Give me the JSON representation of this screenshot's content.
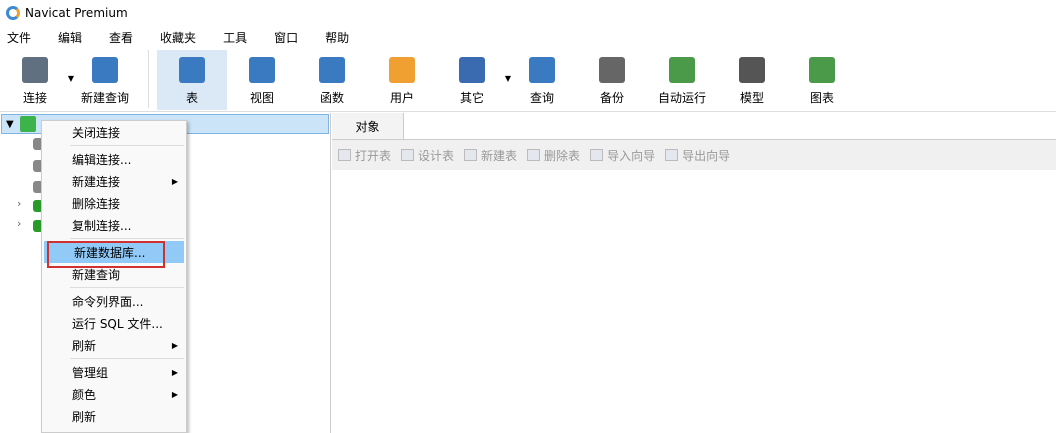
{
  "title": "Navicat Premium",
  "menubar": [
    "文件",
    "编辑",
    "查看",
    "收藏夹",
    "工具",
    "窗口",
    "帮助"
  ],
  "toolbar": [
    {
      "label": "连接",
      "icon": "plug-icon",
      "color": "#607080"
    },
    {
      "label": "新建查询",
      "icon": "new-query-icon",
      "color": "#3a7ac0"
    },
    {
      "label": "表",
      "icon": "table-icon",
      "color": "#3a7ac0",
      "active": true
    },
    {
      "label": "视图",
      "icon": "view-icon",
      "color": "#3a7ac0"
    },
    {
      "label": "函数",
      "icon": "function-icon",
      "color": "#3a7ac0"
    },
    {
      "label": "用户",
      "icon": "user-icon",
      "color": "#f0a030"
    },
    {
      "label": "其它",
      "icon": "tools-icon",
      "color": "#3a6ab0"
    },
    {
      "label": "查询",
      "icon": "query-icon",
      "color": "#3a7ac0"
    },
    {
      "label": "备份",
      "icon": "backup-icon",
      "color": "#666666"
    },
    {
      "label": "自动运行",
      "icon": "schedule-icon",
      "color": "#4a9a4a"
    },
    {
      "label": "模型",
      "icon": "model-icon",
      "color": "#555555"
    },
    {
      "label": "图表",
      "icon": "chart-icon",
      "color": "#4a9a4a"
    }
  ],
  "tabs": {
    "objects": "对象"
  },
  "object_toolbar": [
    "打开表",
    "设计表",
    "新建表",
    "删除表",
    "导入向导",
    "导出向导"
  ],
  "context_menu": [
    {
      "label": "关闭连接"
    },
    {
      "sep": true
    },
    {
      "label": "编辑连接..."
    },
    {
      "label": "新建连接",
      "sub": true
    },
    {
      "label": "删除连接"
    },
    {
      "label": "复制连接..."
    },
    {
      "sep": true
    },
    {
      "label": "新建数据库...",
      "highlight": true
    },
    {
      "label": "新建查询"
    },
    {
      "sep": true
    },
    {
      "label": "命令列界面..."
    },
    {
      "label": "运行 SQL 文件..."
    },
    {
      "label": "刷新",
      "sub": true
    },
    {
      "sep": true
    },
    {
      "label": "管理组",
      "sub": true
    },
    {
      "label": "颜色",
      "sub": true
    },
    {
      "label": "刷新"
    }
  ]
}
